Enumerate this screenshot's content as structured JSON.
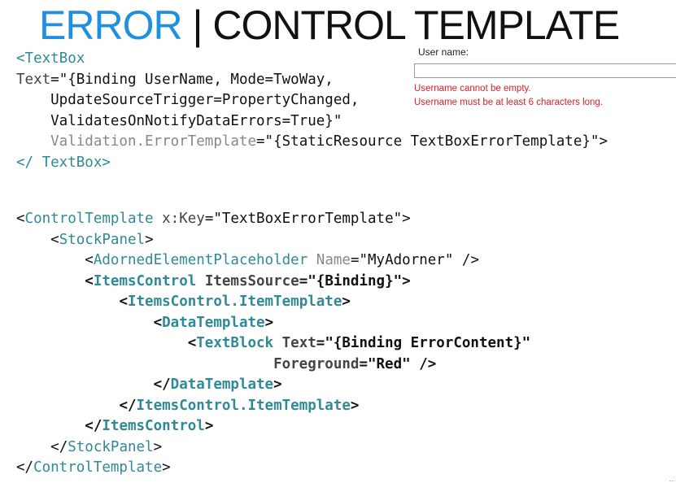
{
  "title": {
    "accent": "ERROR",
    "separator": " | ",
    "rest": "CONTROL TEMPLATE"
  },
  "preview": {
    "label": "User name:",
    "input_value": "",
    "errors": [
      "Username cannot be empty.",
      "Username must be at least 6 characters long."
    ]
  },
  "code_textbox": {
    "l1_tag": "<TextBox",
    "l2_attr": "Text",
    "l2_val": "=\"{Binding UserName, Mode=TwoWay,",
    "l3_val": "    UpdateSourceTrigger=PropertyChanged,",
    "l4_val": "    ValidatesOnNotifyDataErrors=True}\"",
    "l5_attr": "    Validation.ErrorTemplate",
    "l5_val": "=\"{StaticResource TextBoxErrorTemplate}\">",
    "l6_close": "</ TextBox>"
  },
  "code_template": {
    "l1_open": "<",
    "l1_tag": "ControlTemplate",
    "l1_attr": " x:Key",
    "l1_val": "=\"TextBoxErrorTemplate\">",
    "l2_indent": "    ",
    "l2_open": "<",
    "l2_tag": "StockPanel",
    "l2_close": ">",
    "l3_indent": "        ",
    "l3_open": "<",
    "l3_tag": "AdornedElementPlaceholder",
    "l3_attr": " Name",
    "l3_val": "=\"MyAdorner\" />",
    "l4_indent": "        ",
    "l4_open": "<",
    "l4_tag": "ItemsControl",
    "l4_attr": " ItemsSource",
    "l4_val": "=\"{Binding}\">",
    "l5_indent": "            ",
    "l5_open": "<",
    "l5_tag": "ItemsControl.ItemTemplate",
    "l5_close": ">",
    "l6_indent": "                ",
    "l6_open": "<",
    "l6_tag": "DataTemplate",
    "l6_close": ">",
    "l7_indent": "                    ",
    "l7_open": "<",
    "l7_tag": "TextBlock",
    "l7_attr": " Text",
    "l7_val": "=\"{Binding ErrorContent}\"",
    "l8_indent": "                              ",
    "l8_attr": "Foreground",
    "l8_val": "=\"Red\" />",
    "l9_indent": "                ",
    "l9_open": "</",
    "l9_tag": "DataTemplate",
    "l9_close": ">",
    "l10_indent": "            ",
    "l10_open": "</",
    "l10_tag": "ItemsControl.ItemTemplate",
    "l10_close": ">",
    "l11_indent": "        ",
    "l11_open": "</",
    "l11_tag": "ItemsControl",
    "l11_close": ">",
    "l12_indent": "    ",
    "l12_open": "</",
    "l12_tag": "StockPanel",
    "l12_close": ">",
    "l13_open": "</",
    "l13_tag": "ControlTemplate",
    "l13_close": ">"
  },
  "colors": {
    "title_accent": "#1e90e0",
    "xml_tag": "#2e8a96",
    "error_text": "#e02020"
  }
}
